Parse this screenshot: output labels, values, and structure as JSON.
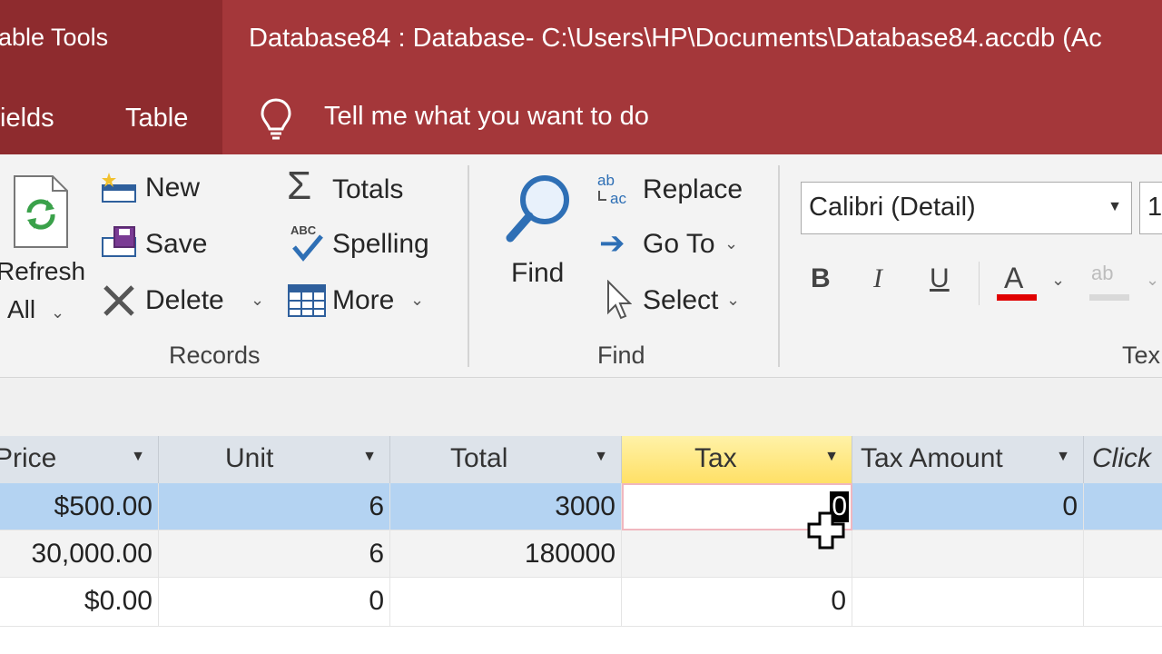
{
  "title_bar": {
    "context_group": "able Tools",
    "document_title": "Database84 : Database- C:\\Users\\HP\\Documents\\Database84.accdb (Ac"
  },
  "tabs": {
    "fields": "ields",
    "table": "Table",
    "tell_me": "Tell me what you want to do"
  },
  "ribbon": {
    "records": {
      "refresh_line1": "Refresh",
      "refresh_line2": "All",
      "new": "New",
      "save": "Save",
      "delete": "Delete",
      "totals": "Totals",
      "spelling": "Spelling",
      "more": "More",
      "group_label": "Records"
    },
    "find": {
      "find": "Find",
      "replace": "Replace",
      "goto": "Go To",
      "select": "Select",
      "group_label": "Find"
    },
    "text_formatting": {
      "font_name": "Calibri (Detail)",
      "font_size": "1",
      "bold": "B",
      "italic": "I",
      "underline": "U",
      "font_color_glyph": "A",
      "highlight_glyph": "ab",
      "group_label": "Tex"
    }
  },
  "grid": {
    "headers": {
      "price": "Price",
      "unit": "Unit",
      "total": "Total",
      "tax": "Tax",
      "tax_amount": "Tax Amount",
      "click": "Click"
    },
    "rows": [
      {
        "price": "$500.00",
        "unit": "6",
        "total": "3000",
        "tax": "0",
        "tax_amount": "0"
      },
      {
        "price": "30,000.00",
        "unit": "6",
        "total": "180000",
        "tax": "",
        "tax_amount": ""
      },
      {
        "price": "$0.00",
        "unit": "0",
        "total": "",
        "tax": "0",
        "tax_amount": ""
      }
    ]
  },
  "colors": {
    "title_bar": "#a4373a",
    "context_tab": "#8e2b2e",
    "selected_row": "#b4d3f2",
    "active_header": "#ffe680",
    "font_color_bar": "#e00000"
  }
}
